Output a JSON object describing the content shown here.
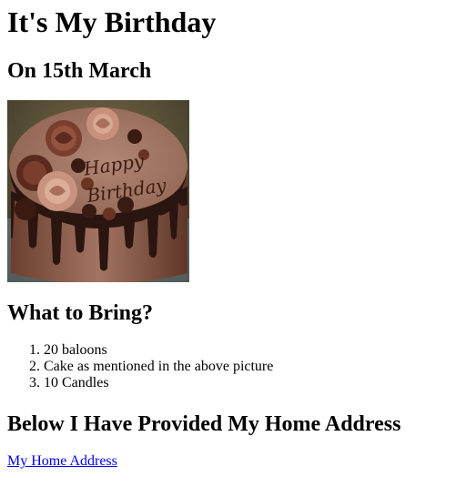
{
  "heading": "It's My Birthday",
  "date_heading": "On 15th March",
  "cake_image": {
    "alt_icon": "birthday-cake-image",
    "cake_text_line1": "Happy",
    "cake_text_line2": "Birthday"
  },
  "bring_heading": "What to Bring?",
  "items": [
    "20 baloons",
    "Cake as mentioned in the above picture",
    "10 Candles"
  ],
  "address_heading": "Below I Have Provided My Home Address",
  "address_link": "My Home Address",
  "colors": {
    "link": "#0000ee",
    "text": "#000000",
    "frosting": "#8b5a48",
    "chocolate": "#2a1510"
  }
}
